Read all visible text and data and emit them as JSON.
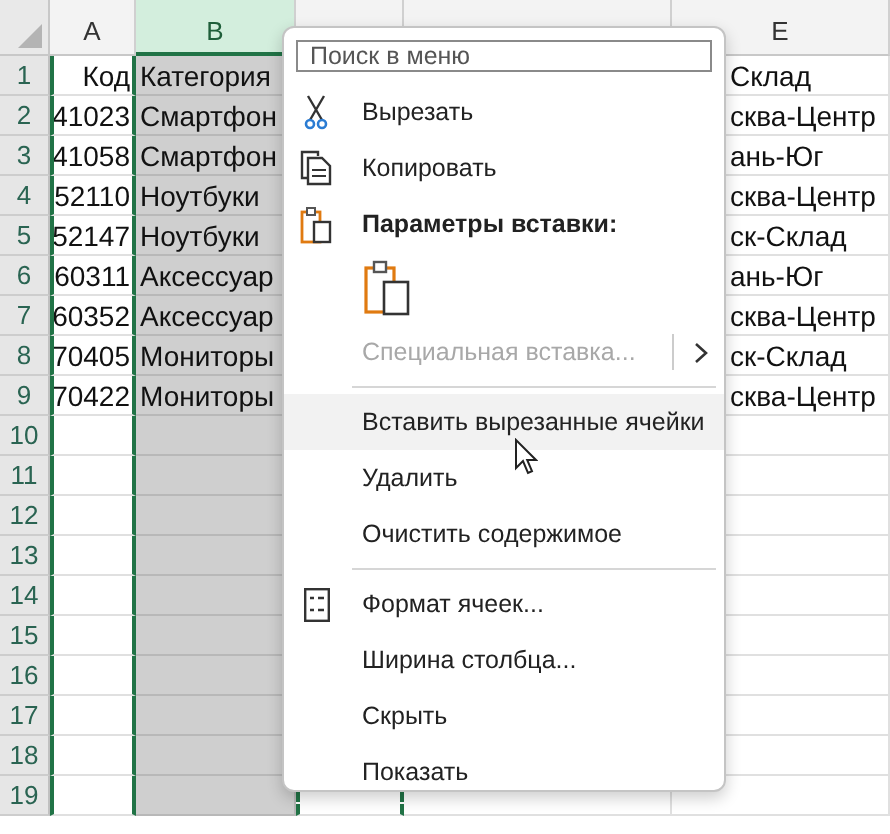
{
  "columns": [
    {
      "label": "A",
      "selected": false
    },
    {
      "label": "B",
      "selected": true
    },
    {
      "selected": false
    },
    {
      "selected": false
    },
    {
      "label": "E",
      "selected": false
    }
  ],
  "rows": [
    {
      "num": "1",
      "cells": [
        "Код",
        "Категория",
        "",
        "",
        "Склад"
      ]
    },
    {
      "num": "2",
      "cells": [
        "41023",
        "Смартфон",
        "",
        "",
        "сква-Центр"
      ]
    },
    {
      "num": "3",
      "cells": [
        "41058",
        "Смартфон",
        "",
        "",
        "ань-Юг"
      ]
    },
    {
      "num": "4",
      "cells": [
        "52110",
        "Ноутбуки",
        "",
        "",
        "сква-Центр"
      ]
    },
    {
      "num": "5",
      "cells": [
        "52147",
        "Ноутбуки",
        "",
        "",
        "ск-Склад"
      ]
    },
    {
      "num": "6",
      "cells": [
        "60311",
        "Аксессуар",
        "",
        "",
        "ань-Юг"
      ]
    },
    {
      "num": "7",
      "cells": [
        "60352",
        "Аксессуар",
        "",
        "",
        "сква-Центр"
      ]
    },
    {
      "num": "8",
      "cells": [
        "70405",
        "Мониторы",
        "",
        "",
        "ск-Склад"
      ]
    },
    {
      "num": "9",
      "cells": [
        "70422",
        "Мониторы",
        "",
        "",
        "сква-Центр"
      ]
    },
    {
      "num": "10",
      "cells": [
        "",
        "",
        "",
        "",
        ""
      ]
    },
    {
      "num": "11",
      "cells": [
        "",
        "",
        "",
        "",
        ""
      ]
    },
    {
      "num": "12",
      "cells": [
        "",
        "",
        "",
        "",
        ""
      ]
    },
    {
      "num": "13",
      "cells": [
        "",
        "",
        "",
        "",
        ""
      ]
    },
    {
      "num": "14",
      "cells": [
        "",
        "",
        "",
        "",
        ""
      ]
    },
    {
      "num": "15",
      "cells": [
        "",
        "",
        "",
        "",
        ""
      ]
    },
    {
      "num": "16",
      "cells": [
        "",
        "",
        "",
        "",
        ""
      ]
    },
    {
      "num": "17",
      "cells": [
        "",
        "",
        "",
        "",
        ""
      ]
    },
    {
      "num": "18",
      "cells": [
        "",
        "",
        "",
        "",
        ""
      ]
    },
    {
      "num": "19",
      "cells": [
        "",
        "",
        "",
        "",
        ""
      ]
    }
  ],
  "context_menu": {
    "search": {
      "placeholder": "Поиск в меню"
    },
    "items": [
      {
        "kind": "cut",
        "label": "Вырезать",
        "disabled": false,
        "hovered": false
      },
      {
        "kind": "copy",
        "label": "Копировать",
        "disabled": false,
        "hovered": false
      },
      {
        "kind": "paste-header",
        "label": "Параметры вставки:",
        "disabled": false,
        "hovered": false
      },
      {
        "kind": "paste-option"
      },
      {
        "kind": "submenu",
        "label": "Специальная вставка...",
        "disabled": true,
        "hovered": false
      },
      {
        "kind": "separator"
      },
      {
        "kind": "command",
        "label": "Вставить вырезанные ячейки",
        "disabled": false,
        "hovered": true
      },
      {
        "kind": "command",
        "label": "Удалить",
        "disabled": false,
        "hovered": false
      },
      {
        "kind": "command",
        "label": "Очистить содержимое",
        "disabled": false,
        "hovered": false
      },
      {
        "kind": "separator"
      },
      {
        "kind": "format",
        "label": "Формат ячеек...",
        "disabled": false,
        "hovered": false
      },
      {
        "kind": "command",
        "label": "Ширина столбца...",
        "disabled": false,
        "hovered": false
      },
      {
        "kind": "command",
        "label": "Скрыть",
        "disabled": false,
        "hovered": false
      },
      {
        "kind": "command",
        "label": "Показать",
        "disabled": false,
        "hovered": false
      }
    ]
  }
}
